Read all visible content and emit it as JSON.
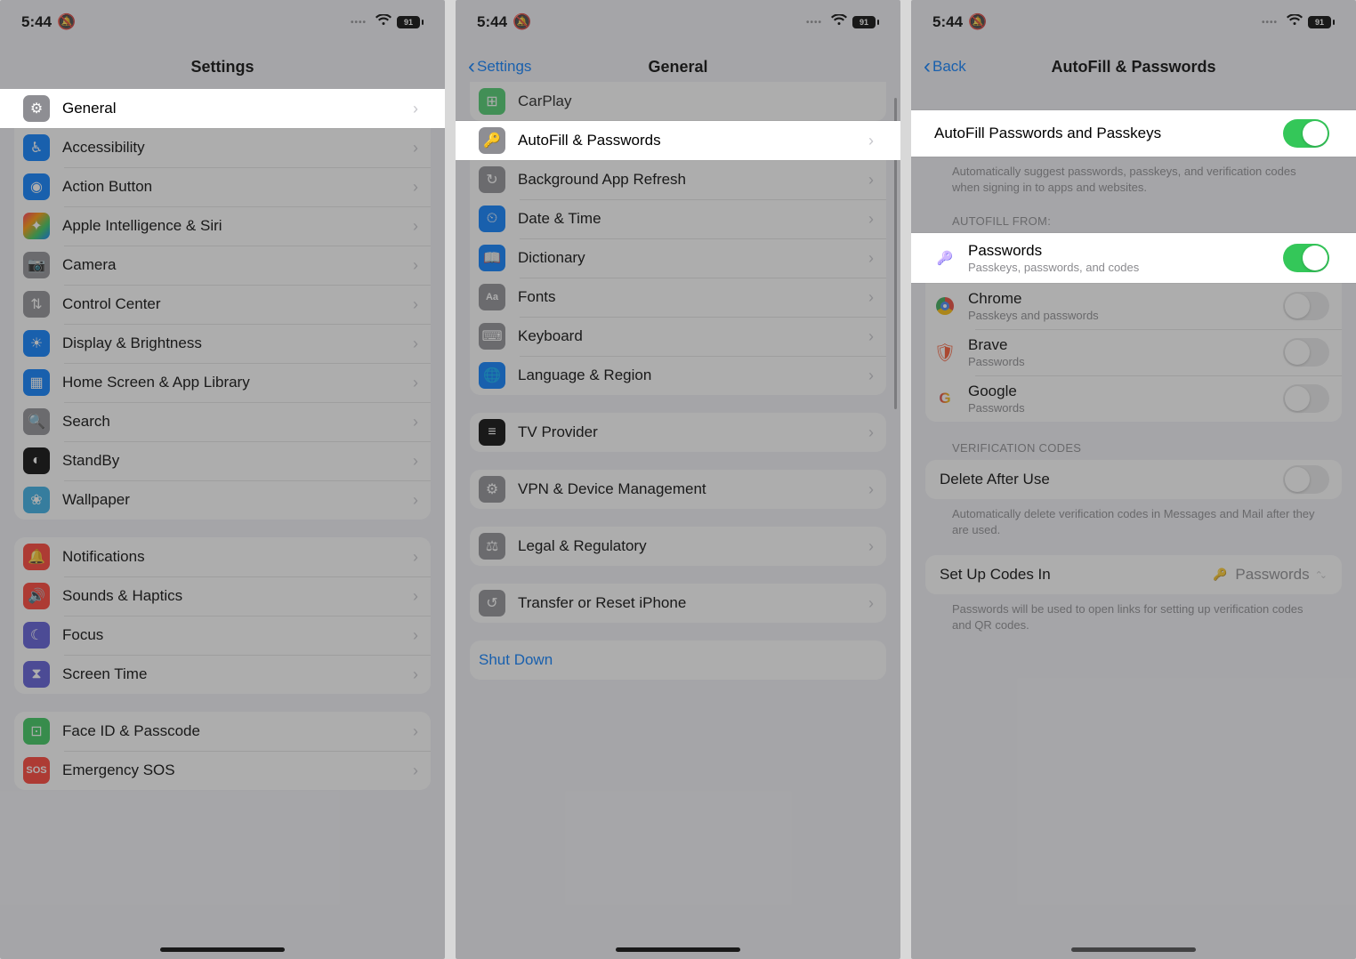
{
  "status": {
    "time": "5:44",
    "battery": "91"
  },
  "screen1": {
    "title": "Settings",
    "groups": [
      {
        "rows": [
          {
            "label": "General",
            "icon": "gear",
            "color": "bg-gray",
            "hi": true
          },
          {
            "label": "Accessibility",
            "icon": "figure",
            "color": "bg-blue"
          },
          {
            "label": "Action Button",
            "icon": "action",
            "color": "bg-blue"
          },
          {
            "label": "Apple Intelligence & Siri",
            "icon": "sparkle",
            "color": "bg-gradient"
          },
          {
            "label": "Camera",
            "icon": "camera",
            "color": "bg-gray"
          },
          {
            "label": "Control Center",
            "icon": "switches",
            "color": "bg-gray"
          },
          {
            "label": "Display & Brightness",
            "icon": "sun",
            "color": "bg-blue"
          },
          {
            "label": "Home Screen & App Library",
            "icon": "grid",
            "color": "bg-blue"
          },
          {
            "label": "Search",
            "icon": "search",
            "color": "bg-gray"
          },
          {
            "label": "StandBy",
            "icon": "standby",
            "color": "bg-black"
          },
          {
            "label": "Wallpaper",
            "icon": "flower",
            "color": "bg-teal"
          }
        ]
      },
      {
        "rows": [
          {
            "label": "Notifications",
            "icon": "bell",
            "color": "bg-red"
          },
          {
            "label": "Sounds & Haptics",
            "icon": "speaker",
            "color": "bg-red"
          },
          {
            "label": "Focus",
            "icon": "moon",
            "color": "bg-indigo"
          },
          {
            "label": "Screen Time",
            "icon": "hourglass",
            "color": "bg-indigo"
          }
        ]
      },
      {
        "rows": [
          {
            "label": "Face ID & Passcode",
            "icon": "faceid",
            "color": "bg-green"
          },
          {
            "label": "Emergency SOS",
            "icon": "sos",
            "color": "bg-red"
          }
        ]
      }
    ]
  },
  "screen2": {
    "back": "Settings",
    "title": "General",
    "pre_row": {
      "label": "CarPlay",
      "icon": "car",
      "color": "bg-green"
    },
    "groups": [
      {
        "rows": [
          {
            "label": "AutoFill & Passwords",
            "icon": "key",
            "color": "bg-gray",
            "hi": true
          },
          {
            "label": "Background App Refresh",
            "icon": "refresh",
            "color": "bg-gray"
          },
          {
            "label": "Date & Time",
            "icon": "calendar",
            "color": "bg-blue"
          },
          {
            "label": "Dictionary",
            "icon": "book",
            "color": "bg-blue"
          },
          {
            "label": "Fonts",
            "icon": "Aa",
            "color": "bg-gray"
          },
          {
            "label": "Keyboard",
            "icon": "keyboard",
            "color": "bg-gray"
          },
          {
            "label": "Language & Region",
            "icon": "globe",
            "color": "bg-blue"
          }
        ]
      },
      {
        "rows": [
          {
            "label": "TV Provider",
            "icon": "tv",
            "color": "bg-black"
          }
        ]
      },
      {
        "rows": [
          {
            "label": "VPN & Device Management",
            "icon": "vpn",
            "color": "bg-gray"
          }
        ]
      },
      {
        "rows": [
          {
            "label": "Legal & Regulatory",
            "icon": "legal",
            "color": "bg-gray"
          }
        ]
      },
      {
        "rows": [
          {
            "label": "Transfer or Reset iPhone",
            "icon": "reset",
            "color": "bg-gray"
          }
        ]
      }
    ],
    "shutdown": "Shut Down"
  },
  "screen3": {
    "back": "Back",
    "title": "AutoFill & Passwords",
    "master_toggle": {
      "label": "AutoFill Passwords and Passkeys",
      "on": true,
      "hi": true
    },
    "master_footer": "Automatically suggest passwords, passkeys, and verification codes when signing in to apps and websites.",
    "autofill_header": "AUTOFILL FROM:",
    "providers": [
      {
        "label": "Passwords",
        "sub": "Passkeys, passwords, and codes",
        "on": true,
        "hi": true,
        "logo": "passwords"
      },
      {
        "label": "Chrome",
        "sub": "Passkeys and passwords",
        "on": false,
        "logo": "chrome"
      },
      {
        "label": "Brave",
        "sub": "Passwords",
        "on": false,
        "logo": "brave"
      },
      {
        "label": "Google",
        "sub": "Passwords",
        "on": false,
        "logo": "google"
      }
    ],
    "verif_header": "VERIFICATION CODES",
    "delete_row": {
      "label": "Delete After Use",
      "on": false
    },
    "delete_footer": "Automatically delete verification codes in Messages and Mail after they are used.",
    "setup_row": {
      "label": "Set Up Codes In",
      "value": "Passwords"
    },
    "setup_footer": "Passwords will be used to open links for setting up verification codes and QR codes."
  }
}
